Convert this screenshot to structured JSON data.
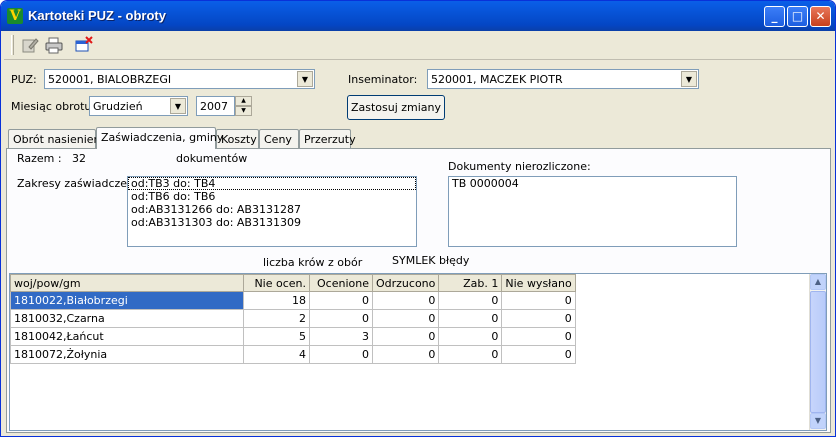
{
  "window": {
    "title": "Kartoteki PUZ - obroty",
    "icon": "app-v-icon",
    "controls": {
      "minimize": "_",
      "maximize": "□",
      "close": "✕"
    }
  },
  "toolbar": {
    "tools": [
      "edit-icon",
      "print-icon",
      "close-window-icon"
    ]
  },
  "form": {
    "puz_label": "PUZ:",
    "puz_value": "520001, BIALOBRZEGI",
    "inseminator_label": "Inseminator:",
    "inseminator_value": "520001, MACZEK PIOTR",
    "month_label": "Miesiąc obrotu :",
    "month_value": "Grudzień",
    "year_value": "2007",
    "apply_button": "Zastosuj zmiany"
  },
  "tabs": [
    {
      "label": "Obrót nasieniem",
      "active": false
    },
    {
      "label": "Zaświadczenia, gminy",
      "active": true
    },
    {
      "label": "Koszty",
      "active": false
    },
    {
      "label": "Ceny",
      "active": false
    },
    {
      "label": "Przerzuty",
      "active": false
    }
  ],
  "summary": {
    "total_label": "Razem :",
    "total_value": "32",
    "total_unit": "dokumentów",
    "ranges_label": "Zakresy zaświadczeń :",
    "ranges": [
      "od:TB3 do: TB4",
      "od:TB6 do: TB6",
      "od:AB3131266 do: AB3131287",
      "od:AB3131303 do: AB3131309"
    ],
    "unsettled_label": "Dokumenty nierozliczone:",
    "unsettled": [
      "TB 0000004"
    ],
    "cows_caption": "liczba krów z obór",
    "symlek_caption": "SYMLEK błędy"
  },
  "grid": {
    "columns": [
      "woj/pow/gm",
      "Nie ocen.",
      "Ocenione",
      "Odrzucono",
      "Zab. 1",
      "Nie wysłano"
    ],
    "rows": [
      {
        "name": "1810022,Białobrzegi",
        "nie_ocen": "18",
        "ocenione": "0",
        "odrzucono": "0",
        "zab1": "0",
        "nie_wyslano": "0",
        "selected": true
      },
      {
        "name": "1810032,Czarna",
        "nie_ocen": "2",
        "ocenione": "0",
        "odrzucono": "0",
        "zab1": "0",
        "nie_wyslano": "0",
        "selected": false
      },
      {
        "name": "1810042,Łańcut",
        "nie_ocen": "5",
        "ocenione": "3",
        "odrzucono": "0",
        "zab1": "0",
        "nie_wyslano": "0",
        "selected": false
      },
      {
        "name": "1810072,Żołynia",
        "nie_ocen": "4",
        "ocenione": "0",
        "odrzucono": "0",
        "zab1": "0",
        "nie_wyslano": "0",
        "selected": false
      }
    ]
  },
  "colors": {
    "titlebar": "#0753d6",
    "selection": "#316ac5",
    "face": "#ece9d8"
  }
}
